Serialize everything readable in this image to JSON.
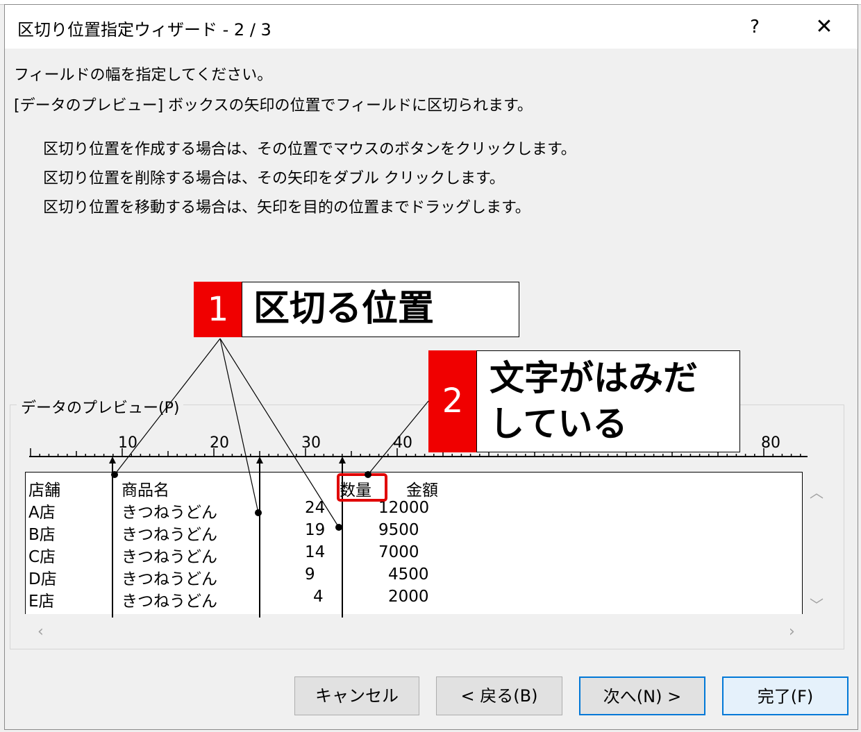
{
  "dialog": {
    "title": "区切り位置指定ウィザード - 2 / 3",
    "help_label": "?",
    "close_label": "✕"
  },
  "instructions": {
    "line1": "フィールドの幅を指定してください。",
    "line2": "[データのプレビュー] ボックスの矢印の位置でフィールドに区切られます。",
    "bullet1": "区切り位置を作成する場合は、その位置でマウスのボタンをクリックします。",
    "bullet2": "区切り位置を削除する場合は、その矢印をダブル クリックします。",
    "bullet3": "区切り位置を移動する場合は、矢印を目的の位置までドラッグします。"
  },
  "preview": {
    "label": "データのプレビュー(P)",
    "ruler_labels": [
      "10",
      "20",
      "30",
      "40",
      "80"
    ],
    "rows": [
      [
        "店舗",
        "商品名",
        "",
        "数量",
        "金額"
      ],
      [
        "A店",
        "きつねうどん",
        "24",
        "12000",
        ""
      ],
      [
        "B店",
        "きつねうどん",
        "19",
        "9500",
        ""
      ],
      [
        "C店",
        "きつねうどん",
        "14",
        "7000",
        ""
      ],
      [
        "D店",
        "きつねうどん",
        "9",
        "4500",
        ""
      ],
      [
        "E店",
        "きつねうどん",
        "4",
        "2000",
        ""
      ]
    ]
  },
  "buttons": {
    "cancel": "キャンセル",
    "back": "< 戻る(B)",
    "next": "次へ(N) >",
    "finish": "完了(F)"
  },
  "callouts": {
    "c1_number": "1",
    "c1_text": "区切る位置",
    "c2_number": "2",
    "c2_line1": "文字がはみだ",
    "c2_line2": "している"
  },
  "colors": {
    "callout_red": "#f00000",
    "accent_blue": "#0078d7"
  },
  "icons": {
    "scroll_up": "chevron-up-icon",
    "scroll_down": "chevron-down-icon",
    "scroll_left": "chevron-left-icon",
    "scroll_right": "chevron-right-icon"
  }
}
